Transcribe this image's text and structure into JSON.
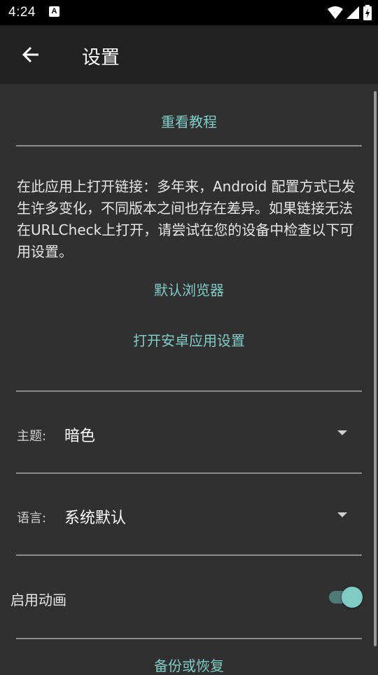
{
  "status_bar": {
    "time": "4:24",
    "notification_icon_letter": "A",
    "icons": [
      "wifi-icon",
      "signal-icon",
      "battery-charging-icon"
    ]
  },
  "app_bar": {
    "title": "设置",
    "back_icon": "arrow-back-icon"
  },
  "settings": {
    "tutorial_button": "重看教程",
    "info_text": "在此应用上打开链接：多年来，Android 配置方式已发生许多变化，不同版本之间也存在差异。如果链接无法在URLCheck上打开，请尝试在您的设备中检查以下可用设置。",
    "default_browser_button": "默认浏览器",
    "android_settings_button": "打开安卓应用设置",
    "theme": {
      "label": "主题:",
      "value": "暗色"
    },
    "language": {
      "label": "语言:",
      "value": "系统默认"
    },
    "animations": {
      "label": "启用动画",
      "enabled": true
    },
    "backup_button": "备份或恢复"
  },
  "colors": {
    "accent": "#80cbc4",
    "background": "#303030",
    "app_bar": "#212121"
  }
}
